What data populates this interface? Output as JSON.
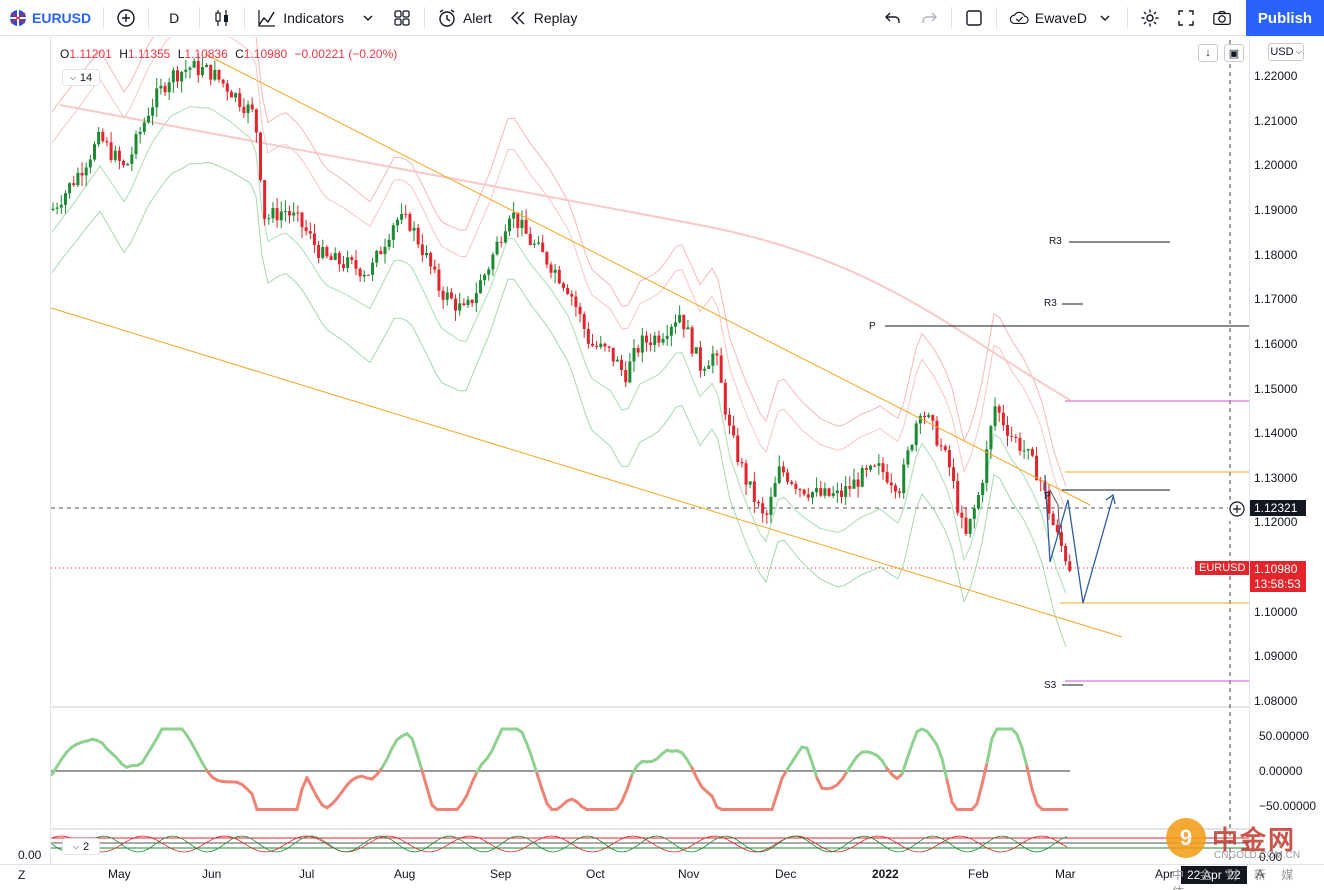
{
  "toolbar": {
    "symbol": "EURUSD",
    "interval": "D",
    "indicators_label": "Indicators",
    "alert_label": "Alert",
    "replay_label": "Replay",
    "layout_name": "EwaveD",
    "publish_label": "Publish",
    "icons": [
      "flag-icon",
      "add-icon",
      "candles-icon",
      "indicators-icon",
      "chevron-down-icon",
      "templates-icon",
      "alert-icon",
      "replay-icon",
      "undo-icon",
      "redo-icon",
      "rectangle-icon",
      "cloud-icon",
      "settings-icon",
      "fullscreen-icon",
      "camera-icon"
    ]
  },
  "legend": {
    "o_label": "O",
    "o": "1.11201",
    "h_label": "H",
    "h": "1.11355",
    "l_label": "L",
    "l": "1.10836",
    "c_label": "C",
    "c": "1.10980",
    "change": "−0.00221 (−0.20%)",
    "length_main": "14",
    "length_osc": "2"
  },
  "price_axis": {
    "currency": "USD",
    "ticks": [
      "1.22000",
      "1.21000",
      "1.20000",
      "1.19000",
      "1.18000",
      "1.17000",
      "1.16000",
      "1.15000",
      "1.14000",
      "1.13000",
      "1.12000",
      "1.11000",
      "1.10000",
      "1.09000",
      "1.08000"
    ],
    "crosshair_value": "1.12321",
    "last_symbol": "EURUSD",
    "last_price": "1.10980",
    "countdown": "13:58:53"
  },
  "osc_axis": {
    "ticks": [
      "50.00000",
      "0.00000",
      "−50.00000"
    ],
    "lower_value": "0.00",
    "left_value": "0.00"
  },
  "time_axis": {
    "labels": [
      "May",
      "Jun",
      "Jul",
      "Aug",
      "Sep",
      "Oct",
      "Nov",
      "Dec",
      "2022",
      "Feb",
      "Mar",
      "Apr",
      "A"
    ],
    "cursor_date": "22 Apr '22"
  },
  "annotations": {
    "r3_a": "R3",
    "r3_b": "R3",
    "p_a": "P",
    "p_b": "P",
    "s3": "S3"
  },
  "bottom": {
    "tz_label": "Z"
  },
  "watermark": {
    "logo_char": "9",
    "name": "中金网",
    "site": "CNGOLD.COM.CN",
    "tag": "中 金 财 新 媒 体"
  },
  "colors": {
    "up": "#1b8a32",
    "down": "#e3242b",
    "accent": "#2962ff",
    "trend": "#f5a623",
    "pivot": "#131722",
    "magenta": "#d64fd6"
  }
}
